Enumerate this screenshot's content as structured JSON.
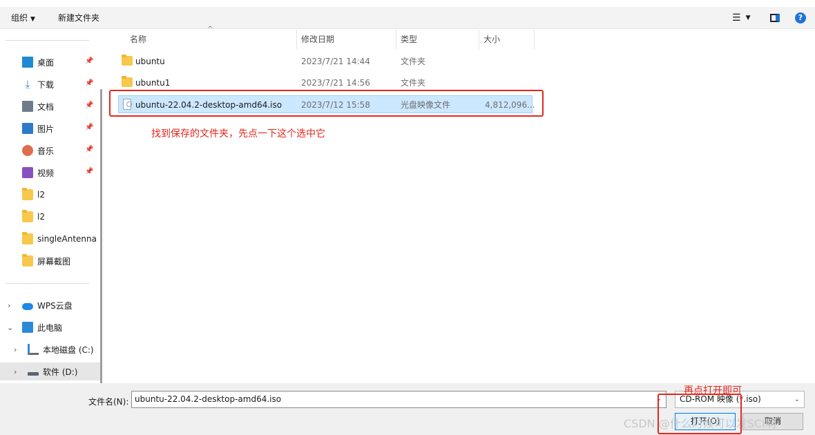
{
  "toolbar": {
    "organize_label": "组织",
    "new_folder_label": "新建文件夹"
  },
  "nav": {
    "quick_access": [
      {
        "label": "桌面",
        "icon": "desktop-icon",
        "pinned": true
      },
      {
        "label": "下载",
        "icon": "download-icon",
        "pinned": true
      },
      {
        "label": "文档",
        "icon": "document-icon",
        "pinned": true
      },
      {
        "label": "图片",
        "icon": "pictures-icon",
        "pinned": true
      },
      {
        "label": "音乐",
        "icon": "music-icon",
        "pinned": true
      },
      {
        "label": "视频",
        "icon": "video-icon",
        "pinned": true
      },
      {
        "label": "l2",
        "icon": "folder-icon",
        "pinned": false
      },
      {
        "label": "l2",
        "icon": "folder-icon",
        "pinned": false
      },
      {
        "label": "singleAntenna",
        "icon": "folder-icon",
        "pinned": false
      },
      {
        "label": "屏幕截图",
        "icon": "folder-icon",
        "pinned": false
      }
    ],
    "wps_cloud": "WPS云盘",
    "this_pc": "此电脑",
    "local_disk": "本地磁盘 (C:)",
    "software_disk": "软件 (D:)"
  },
  "columns": {
    "name": "名称",
    "modified": "修改日期",
    "type": "类型",
    "size": "大小"
  },
  "files": [
    {
      "name": "ubuntu",
      "modified": "2023/7/21 14:44",
      "type": "文件夹",
      "size": ""
    },
    {
      "name": "ubuntu1",
      "modified": "2023/7/21 14:56",
      "type": "文件夹",
      "size": ""
    },
    {
      "name": "ubuntu-22.04.2-desktop-amd64.iso",
      "modified": "2023/7/12 15:58",
      "type": "光盘映像文件",
      "size": "4,812,096..."
    }
  ],
  "annotations": {
    "select_hint": "找到保存的文件夹，先点一下这个选中它",
    "open_hint": "再点打开即可"
  },
  "bottom": {
    "filename_label": "文件名(N):",
    "filename_value": "ubuntu-22.04.2-desktop-amd64.iso",
    "filetype_value": "CD-ROM 映像 (*.iso)",
    "open_label": "打开(O)",
    "cancel_label": "取消"
  },
  "watermark": "CSDN @什么时候可以发SCI啊",
  "colors": {
    "annotation_red": "#e3261c",
    "selection_bg": "#cce8ff",
    "accent": "#0078d7"
  }
}
